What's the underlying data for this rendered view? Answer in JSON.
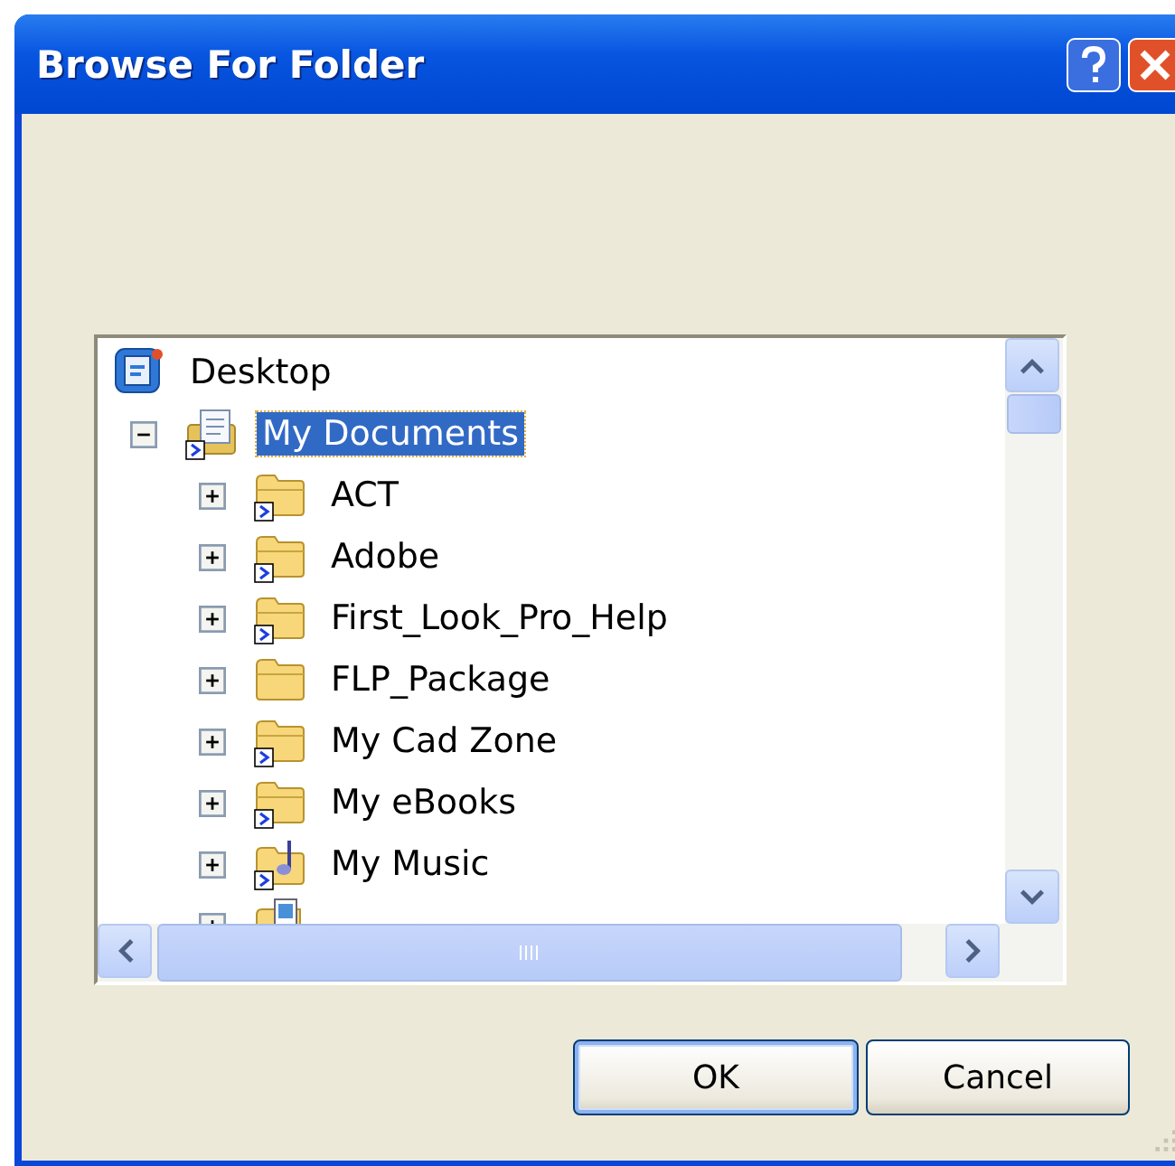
{
  "window": {
    "title": "Browse For Folder"
  },
  "tree": {
    "items": [
      {
        "label": "Desktop",
        "kind": "desktop",
        "selected": false,
        "children": [
          {
            "label": "My Documents",
            "kind": "documents",
            "selected": true,
            "expanded": true,
            "children": [
              {
                "label": "ACT",
                "kind": "shortcut-folder",
                "selected": false,
                "expanded": false
              },
              {
                "label": "Adobe",
                "kind": "shortcut-folder",
                "selected": false,
                "expanded": false
              },
              {
                "label": "First_Look_Pro_Help",
                "kind": "shortcut-folder",
                "selected": false,
                "expanded": false
              },
              {
                "label": "FLP_Package",
                "kind": "folder",
                "selected": false,
                "expanded": false
              },
              {
                "label": "My Cad Zone",
                "kind": "shortcut-folder",
                "selected": false,
                "expanded": false
              },
              {
                "label": "My eBooks",
                "kind": "shortcut-folder",
                "selected": false,
                "expanded": false
              },
              {
                "label": "My Music",
                "kind": "music-folder",
                "selected": false,
                "expanded": false
              },
              {
                "kind": "picture-folder",
                "selected": false,
                "expanded": false
              }
            ]
          }
        ]
      }
    ]
  },
  "buttons": [
    {
      "label": "OK",
      "default": true
    },
    {
      "label": "Cancel",
      "default": false
    }
  ]
}
